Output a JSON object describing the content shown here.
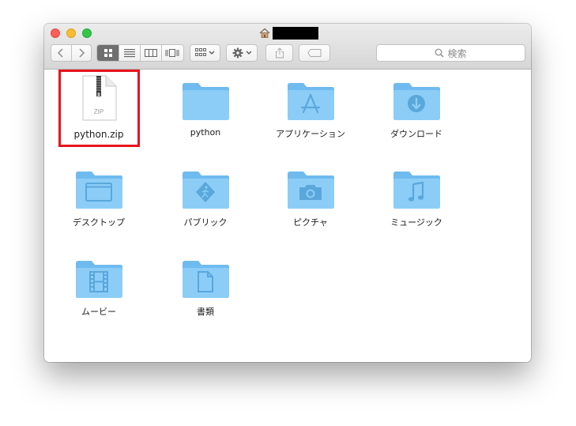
{
  "window": {
    "title_redacted": ""
  },
  "toolbar": {
    "search_placeholder": "検索",
    "view_modes": [
      "icon-view",
      "list-view",
      "column-view",
      "cover-flow-view"
    ],
    "active_view": "icon-view"
  },
  "items": [
    {
      "label": "python.zip",
      "kind": "zip",
      "badge": "ZIP",
      "selected": true
    },
    {
      "label": "python",
      "kind": "folder"
    },
    {
      "label": "アプリケーション",
      "kind": "applications-folder"
    },
    {
      "label": "ダウンロード",
      "kind": "downloads-folder"
    },
    {
      "label": "デスクトップ",
      "kind": "desktop-folder"
    },
    {
      "label": "パブリック",
      "kind": "public-folder"
    },
    {
      "label": "ピクチャ",
      "kind": "pictures-folder"
    },
    {
      "label": "ミュージック",
      "kind": "music-folder"
    },
    {
      "label": "ムービー",
      "kind": "movies-folder"
    },
    {
      "label": "書類",
      "kind": "documents-folder"
    }
  ],
  "colors": {
    "folder": "#8ccdf7",
    "folder_dark": "#6fbbef",
    "highlight": "#e8141e"
  }
}
